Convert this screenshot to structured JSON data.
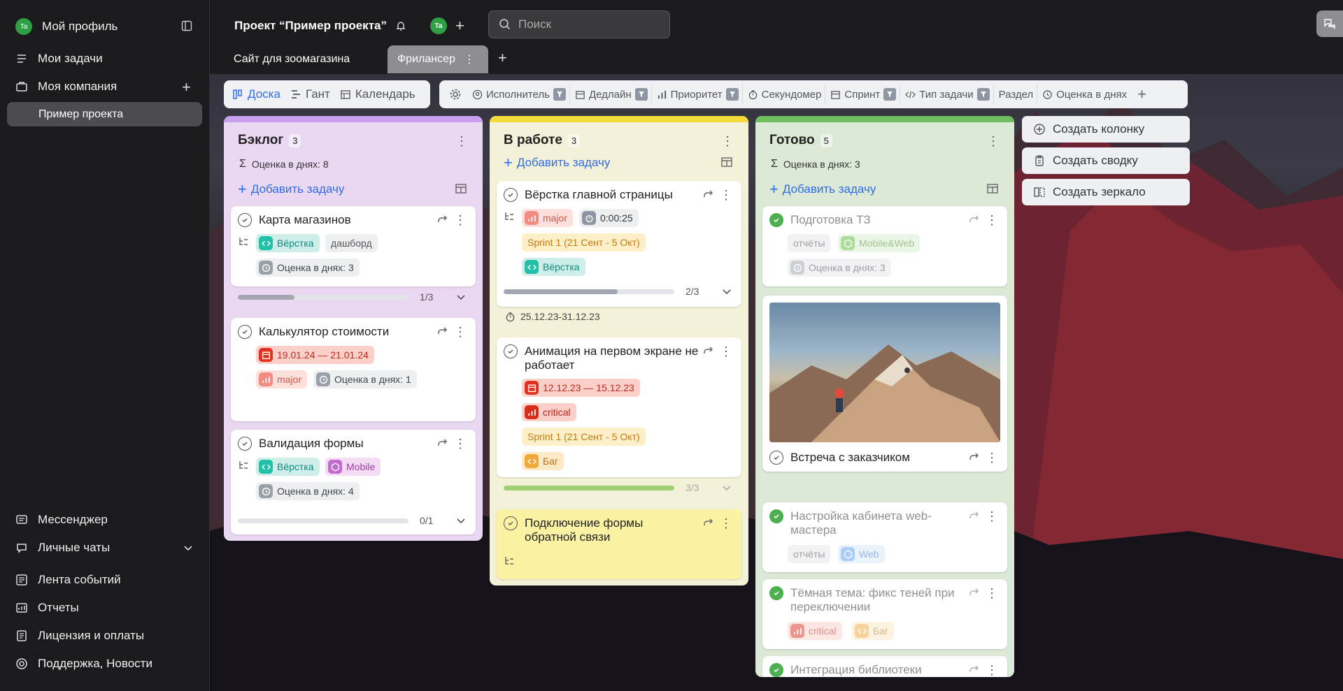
{
  "sidebar": {
    "profile": {
      "avatar": "Ta",
      "label": "Мой профиль"
    },
    "items": [
      {
        "label": "Мои задачи",
        "icon": "tasks-icon"
      },
      {
        "label": "Моя компания",
        "icon": "briefcase-icon"
      }
    ],
    "project": "Пример проекта",
    "bottom": [
      {
        "label": "Мессенджер"
      },
      {
        "label": "Личные чаты"
      },
      {
        "label": "Лента событий"
      },
      {
        "label": "Отчеты"
      },
      {
        "label": "Лицензия и оплаты"
      },
      {
        "label": "Поддержка, Новости"
      }
    ]
  },
  "header": {
    "project_title": "Проект “Пример проекта”",
    "avatar": "Ta",
    "search_placeholder": "Поиск"
  },
  "tabs": [
    {
      "label": "Сайт для зоомагазина"
    },
    {
      "label": "Фрилансер"
    }
  ],
  "views": [
    "Доска",
    "Гант",
    "Календарь"
  ],
  "filters": [
    "Исполнитель",
    "Дедлайн",
    "Приоритет",
    "Секундомер",
    "Спринт",
    "Тип задачи",
    "Раздел",
    "Оценка в днях"
  ],
  "columns": [
    {
      "title": "Бэклог",
      "count": "3",
      "summary": "Оценка в днях: 8",
      "add": "Добавить задачу",
      "color": "#c9a0ef",
      "cards": [
        {
          "title": "Карта магазинов",
          "tags": [
            "Вёрстка",
            "дашборд"
          ],
          "est": "Оценка в днях: 3",
          "progress": "1/3",
          "progress_value": 0.333
        },
        {
          "title": "Калькулятор стоимости",
          "date": "19.01.24 — 21.01.24",
          "priority": "major",
          "est": "Оценка в днях: 1"
        },
        {
          "title": "Валидация формы",
          "tags": [
            "Вёрстка",
            "Mobile"
          ],
          "est": "Оценка в днях: 4",
          "progress": "0/1",
          "progress_value": 0
        }
      ]
    },
    {
      "title": "В работе",
      "count": "3",
      "add": "Добавить задачу",
      "color": "#f3db3c",
      "cards": [
        {
          "title": "Вёрстка главной страницы",
          "priority": "major",
          "timer": "0:00:25",
          "sprint": "Sprint 1 (21 Сент - 5 Окт)",
          "tag": "Вёрстка",
          "progress": "2/3",
          "progress_value": 0.667,
          "dates": "25.12.23-31.12.23"
        },
        {
          "title": "Анимация на первом экране не работает",
          "date": "12.12.23 — 15.12.23",
          "priority": "critical",
          "sprint": "Sprint 1 (21 Сент - 5 Окт)",
          "tag": "Баг",
          "progress": "3/3",
          "progress_value": 1
        },
        {
          "title": "Подключение формы обратной связи"
        }
      ]
    },
    {
      "title": "Готово",
      "count": "5",
      "summary": "Оценка в днях: 3",
      "add": "Добавить задачу",
      "color": "#6fbf60",
      "cards": [
        {
          "title": "Подготовка ТЗ",
          "tags": [
            "отчёты",
            "Mobile&Web"
          ],
          "est": "Оценка в днях: 3"
        },
        {
          "title": "Встреча с заказчиком"
        },
        {
          "title": "Настройка кабинета web-мастера",
          "tags": [
            "отчёты",
            "Web"
          ]
        },
        {
          "title": "Тёмная тема: фикс теней при переключении",
          "priority": "critical",
          "tag": "Баг"
        },
        {
          "title": "Интеграция библиотеки"
        }
      ]
    }
  ],
  "actions": [
    "Создать колонку",
    "Создать сводку",
    "Создать зеркало"
  ]
}
